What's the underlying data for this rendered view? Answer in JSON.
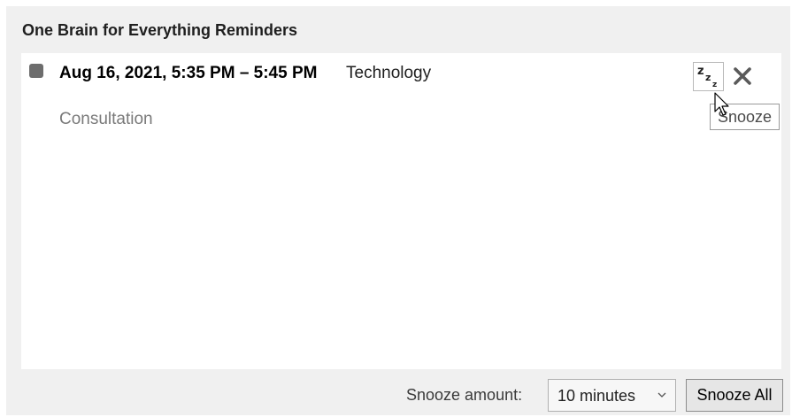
{
  "dialog": {
    "title": "One Brain for Everything Reminders"
  },
  "reminders": [
    {
      "time": "Aug 16, 2021, 5:35 PM – 5:45 PM",
      "subject": "Consultation",
      "category": "Technology",
      "category_color": "#6d6d6d",
      "snooze_icon": "snooze-zzz-icon",
      "dismiss_icon": "close-icon"
    }
  ],
  "tooltip": {
    "text": "Snooze"
  },
  "footer": {
    "snooze_amount_label": "Snooze amount:",
    "snooze_amount_value": "10 minutes",
    "snooze_all_label": "Snooze All"
  }
}
